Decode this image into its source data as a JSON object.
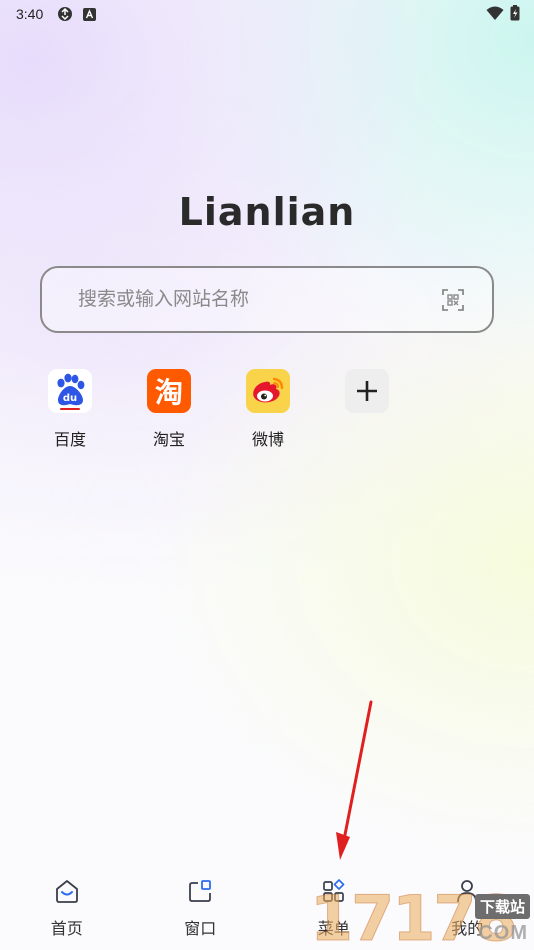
{
  "status_bar": {
    "time": "3:40",
    "icons_left": [
      "sync-icon",
      "a-box-icon"
    ],
    "icons_right": [
      "wifi-icon",
      "battery-icon"
    ]
  },
  "logo": {
    "text": "Lianlian"
  },
  "search": {
    "placeholder": "搜索或输入网站名称",
    "value": "",
    "scan_icon": "scan-qr-icon"
  },
  "shortcuts": [
    {
      "label": "百度",
      "icon": "baidu-icon",
      "color": "#2d55e6"
    },
    {
      "label": "淘宝",
      "icon": "taobao-icon",
      "color": "#ff5a00"
    },
    {
      "label": "微博",
      "icon": "weibo-icon",
      "color": "#e6162d"
    },
    {
      "label": "",
      "icon": "plus-icon",
      "color": "#222222"
    }
  ],
  "bottom_nav": {
    "items": [
      {
        "label": "首页",
        "icon": "home-icon"
      },
      {
        "label": "窗口",
        "icon": "window-icon"
      },
      {
        "label": "菜单",
        "icon": "menu-grid-icon"
      },
      {
        "label": "我的",
        "icon": "person-icon"
      }
    ]
  },
  "colors": {
    "accent": "#2d6cf0",
    "annotation_arrow": "#e02020"
  },
  "watermark": {
    "digits": "17178",
    "tag": "下载站",
    "domain": "COM"
  }
}
